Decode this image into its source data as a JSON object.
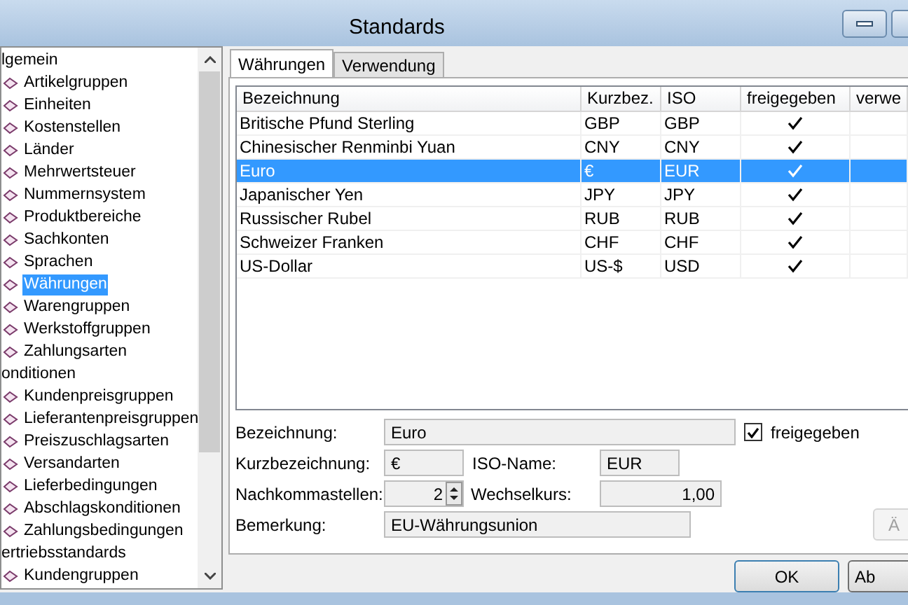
{
  "window": {
    "title": "Standards"
  },
  "tree": [
    {
      "label": "lgemein",
      "children": [
        {
          "label": "Artikelgruppen",
          "selected": false
        },
        {
          "label": "Einheiten",
          "selected": false
        },
        {
          "label": "Kostenstellen",
          "selected": false
        },
        {
          "label": "Länder",
          "selected": false
        },
        {
          "label": "Mehrwertsteuer",
          "selected": false
        },
        {
          "label": "Nummernsystem",
          "selected": false
        },
        {
          "label": "Produktbereiche",
          "selected": false
        },
        {
          "label": "Sachkonten",
          "selected": false
        },
        {
          "label": "Sprachen",
          "selected": false
        },
        {
          "label": "Währungen",
          "selected": true
        },
        {
          "label": "Warengruppen",
          "selected": false
        },
        {
          "label": "Werkstoffgruppen",
          "selected": false
        },
        {
          "label": "Zahlungsarten",
          "selected": false
        }
      ]
    },
    {
      "label": "onditionen",
      "children": [
        {
          "label": "Kundenpreisgruppen",
          "selected": false
        },
        {
          "label": "Lieferantenpreisgruppen",
          "selected": false
        },
        {
          "label": "Preiszuschlagsarten",
          "selected": false
        },
        {
          "label": "Versandarten",
          "selected": false
        },
        {
          "label": "Lieferbedingungen",
          "selected": false
        },
        {
          "label": "Abschlagskonditionen",
          "selected": false
        },
        {
          "label": "Zahlungsbedingungen",
          "selected": false
        }
      ]
    },
    {
      "label": "ertriebsstandards",
      "children": [
        {
          "label": "Kundengruppen",
          "selected": false
        }
      ]
    }
  ],
  "tabs": [
    {
      "label": "Währungen",
      "selected": true
    },
    {
      "label": "Verwendung",
      "selected": false
    }
  ],
  "table": {
    "columns": [
      "Bezeichnung",
      "Kurzbez.",
      "ISO",
      "freigegeben",
      "verwe"
    ],
    "rows": [
      {
        "name": "Britische Pfund Sterling",
        "short": "GBP",
        "iso": "GBP",
        "released": true,
        "selected": false
      },
      {
        "name": "Chinesischer Renminbi Yuan",
        "short": "CNY",
        "iso": "CNY",
        "released": true,
        "selected": false
      },
      {
        "name": "Euro",
        "short": "€",
        "iso": "EUR",
        "released": true,
        "selected": true
      },
      {
        "name": "Japanischer Yen",
        "short": "JPY",
        "iso": "JPY",
        "released": true,
        "selected": false
      },
      {
        "name": "Russischer Rubel",
        "short": "RUB",
        "iso": "RUB",
        "released": true,
        "selected": false
      },
      {
        "name": "Schweizer Franken",
        "short": "CHF",
        "iso": "CHF",
        "released": true,
        "selected": false
      },
      {
        "name": "US-Dollar",
        "short": "US-$",
        "iso": "USD",
        "released": true,
        "selected": false
      }
    ]
  },
  "form": {
    "name_label": "Bezeichnung:",
    "name_value": "Euro",
    "released_label": "freigegeben",
    "released": true,
    "short_label": "Kurzbezeichnung:",
    "short_value": "€",
    "iso_label": "ISO-Name:",
    "iso_value": "EUR",
    "decimals_label": "Nachkommastellen:",
    "decimals_value": "2",
    "rate_label": "Wechselkurs:",
    "rate_value": "1,00",
    "remark_label": "Bemerkung:",
    "remark_value": "EU-Währungsunion",
    "side_button": "Ä",
    "side_button_disabled": true
  },
  "buttons": [
    "OK",
    "Ab"
  ]
}
